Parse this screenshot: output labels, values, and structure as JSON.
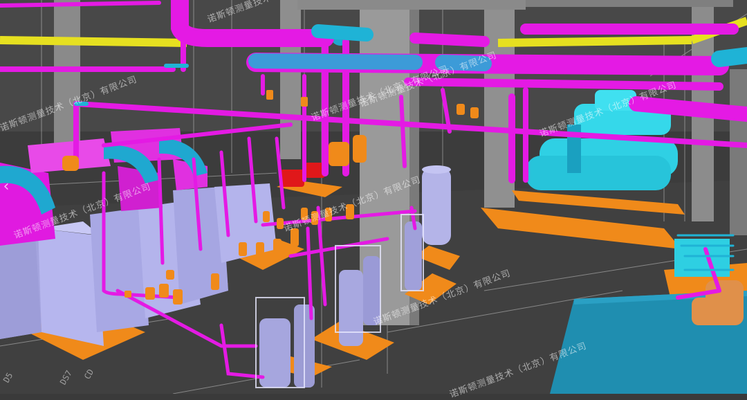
{
  "scene": {
    "type": "bim-3d-mep-model",
    "content": "equipment-room-with-chillers-pumps-and-piping",
    "colors": {
      "floor": "#3a3a3a",
      "structure": "#8f8f8f",
      "pipe_magenta": "#e81ce8",
      "pipe_cyan": "#1fb3d6",
      "pipe_yellow": "#e8e21a",
      "equipment_lavender": "#a8a8e6",
      "base_orange": "#f08a1a",
      "pump_red": "#e01a1a",
      "chiller_cyan": "#2fd8e8",
      "tank_teal": "#1f8fb0"
    }
  },
  "watermarks": [
    "诺斯顿测量技术（北京）有限公司",
    "诺斯顿测量技术（北京）有限公司",
    "诺斯顿测量技术（北京）有限公司",
    "诺斯顿测量技术（北京）有限公司",
    "诺斯顿测量技术（北京）有限公司",
    "诺斯顿测量技术（北京）有限公司",
    "诺斯顿测量技术（北京）有限公司",
    "诺斯顿测量技术（北京）有限公司",
    "诺斯顿测量技术（北京）有限公司"
  ],
  "dimension_labels": [
    "D5",
    "DS7",
    "CD"
  ],
  "nav": {
    "left_arrow_icon": "chevron-left-icon",
    "left_arrow_glyph": "‹"
  }
}
